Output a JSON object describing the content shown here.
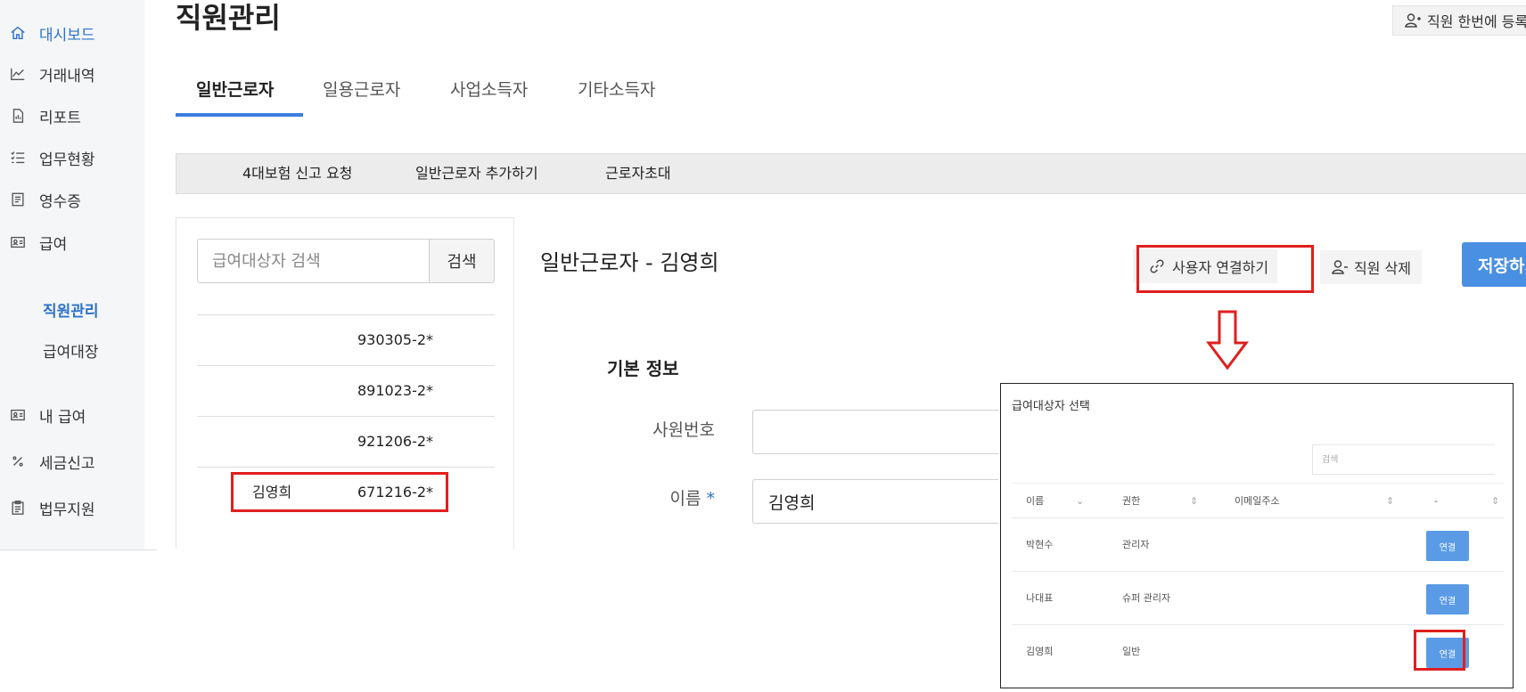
{
  "sidebar": {
    "items": [
      {
        "label": "대시보드",
        "icon": "home-icon",
        "active": true
      },
      {
        "label": "거래내역",
        "icon": "chart-icon"
      },
      {
        "label": "리포트",
        "icon": "report-icon"
      },
      {
        "label": "업무현황",
        "icon": "list-icon"
      },
      {
        "label": "영수증",
        "icon": "receipt-icon"
      },
      {
        "label": "급여",
        "icon": "id-card-icon"
      }
    ],
    "subitems": [
      {
        "label": "직원관리",
        "active": true
      },
      {
        "label": "급여대장"
      }
    ],
    "items2": [
      {
        "label": "내 급여",
        "icon": "id-card-icon"
      },
      {
        "label": "세금신고",
        "icon": "percent-icon"
      },
      {
        "label": "법무지원",
        "icon": "clipboard-icon"
      }
    ]
  },
  "header": {
    "title": "직원관리",
    "bulk_button": "직원 한번에 등록"
  },
  "tabs": [
    "일반근로자",
    "일용근로자",
    "사업소득자",
    "기타소득자"
  ],
  "toolbar": {
    "insurance": "4대보험 신고 요청",
    "add": "일반근로자 추가하기",
    "invite": "근로자초대"
  },
  "employee_list": {
    "search_placeholder": "급여대상자 검색",
    "search_button": "검색",
    "rows": [
      {
        "name": "",
        "rrn": "930305-2*"
      },
      {
        "name": "",
        "rrn": "891023-2*"
      },
      {
        "name": "",
        "rrn": "921206-2*"
      },
      {
        "name": "김영희",
        "rrn": "671216-2*"
      }
    ]
  },
  "detail": {
    "title": "일반근로자 - 김영희",
    "link_user_button": "사용자 연결하기",
    "delete_button": "직원 삭제",
    "save_button": "저장하기",
    "section_basic": "기본 정보",
    "fields": {
      "emp_no_label": "사원번호",
      "emp_no_value": "",
      "name_label": "이름",
      "name_required": "*",
      "name_value": "김영희"
    }
  },
  "modal": {
    "title": "급여대상자 선택",
    "search_placeholder": "검색",
    "columns": [
      "이름",
      "권한",
      "이메일주소",
      "-"
    ],
    "link_label": "연결",
    "rows": [
      {
        "name": "박현수",
        "role": "관리자"
      },
      {
        "name": "나대표",
        "role": "슈퍼 관리자"
      },
      {
        "name": "김영희",
        "role": "일반"
      }
    ]
  },
  "colors": {
    "accent": "#2d72c8",
    "primary_button": "#4a90e2",
    "highlight": "#e01f1f"
  }
}
